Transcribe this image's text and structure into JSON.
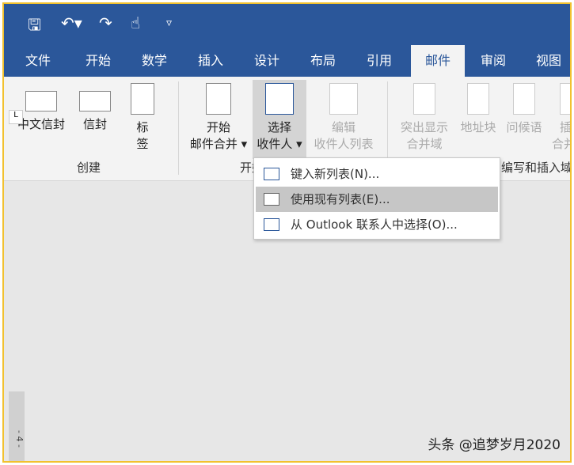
{
  "qat": {
    "save": "🖫",
    "undo": "↶▾",
    "redo": "↷",
    "touch": "☝",
    "customize": "▿"
  },
  "tabs": [
    "文件",
    "开始",
    "数学",
    "插入",
    "设计",
    "布局",
    "引用",
    "邮件",
    "审阅",
    "视图"
  ],
  "active_tab": "邮件",
  "ribbon": {
    "create": {
      "label": "创建",
      "buttons": [
        "中文信封",
        "信封",
        "标\n签"
      ]
    },
    "start": {
      "label": "开始邮件合并",
      "buttons": [
        {
          "l1": "开始",
          "l2": "邮件合并 ▾"
        },
        {
          "l1": "选择",
          "l2": "收件人 ▾"
        },
        {
          "l1": "编辑",
          "l2": "收件人列表"
        }
      ]
    },
    "write": {
      "label": "编写和插入域",
      "buttons": [
        {
          "l1": "突出显示",
          "l2": "合并域"
        },
        {
          "l1": "地址块",
          "l2": ""
        },
        {
          "l1": "问候语",
          "l2": ""
        },
        {
          "l1": "插",
          "l2": "合并"
        }
      ]
    }
  },
  "menu": [
    "键入新列表(N)...",
    "使用现有列表(E)...",
    "从 Outlook 联系人中选择(O)..."
  ],
  "ruler": {
    "corner": "L",
    "vertical": "- 4 -"
  },
  "watermark": "头条 @追梦岁月2020"
}
